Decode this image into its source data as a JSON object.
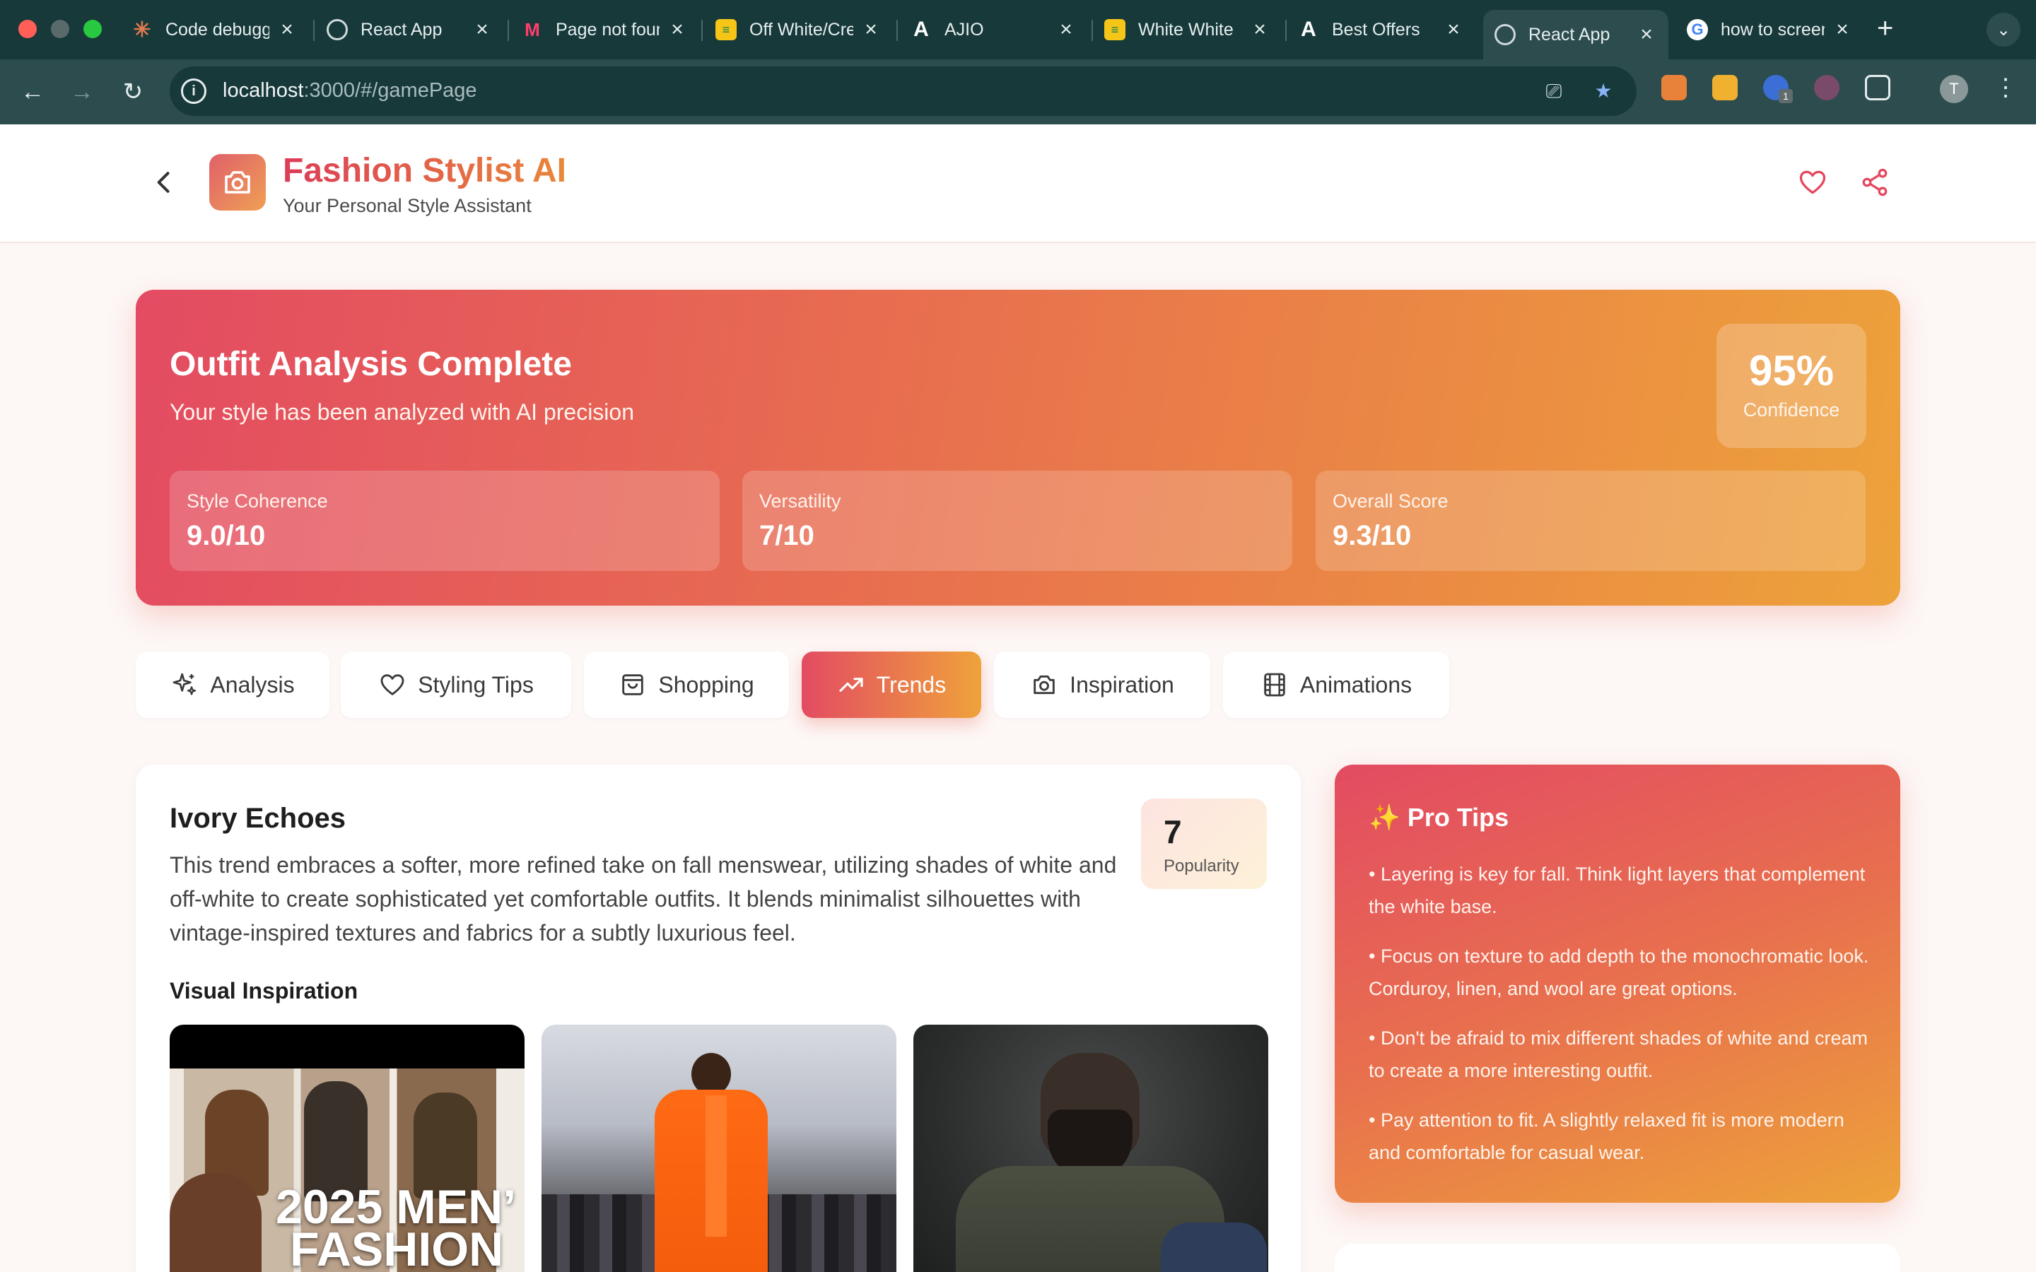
{
  "browser": {
    "tabs": [
      {
        "title": "Code debugging",
        "icon": "claude-icon"
      },
      {
        "title": "React App",
        "icon": "globe-icon"
      },
      {
        "title": "Page not found",
        "icon": "myntra-icon"
      },
      {
        "title": "Off White/Cream",
        "icon": "sticky-note-icon"
      },
      {
        "title": "AJIO",
        "icon": "ajio-icon"
      },
      {
        "title": "White White",
        "icon": "sticky-note-icon"
      },
      {
        "title": "Best Offers",
        "icon": "ajio-icon"
      },
      {
        "title": "React App",
        "icon": "globe-icon",
        "active": true
      },
      {
        "title": "how to screenshot",
        "icon": "google-icon"
      }
    ],
    "url_host": "localhost",
    "url_path": ":3000/#/gamePage",
    "profile_initial": "T",
    "extension_badge": "1"
  },
  "header": {
    "title": "Fashion Stylist AI",
    "subtitle": "Your Personal Style Assistant"
  },
  "hero": {
    "title": "Outfit Analysis Complete",
    "subtitle": "Your style has been analyzed with AI precision",
    "confidence_value": "95%",
    "confidence_label": "Confidence",
    "metrics": [
      {
        "label": "Style Coherence",
        "value": "9.0/10"
      },
      {
        "label": "Versatility",
        "value": "7/10"
      },
      {
        "label": "Overall Score",
        "value": "9.3/10"
      }
    ]
  },
  "tabs": [
    {
      "label": "Analysis",
      "icon": "sparkles-icon"
    },
    {
      "label": "Styling Tips",
      "icon": "heart-icon"
    },
    {
      "label": "Shopping",
      "icon": "shopping-bag-icon"
    },
    {
      "label": "Trends",
      "icon": "trending-up-icon",
      "active": true
    },
    {
      "label": "Inspiration",
      "icon": "camera-icon"
    },
    {
      "label": "Animations",
      "icon": "film-icon"
    }
  ],
  "trend": {
    "name": "Ivory Echoes",
    "description": "This trend embraces a softer, more refined take on fall menswear, utilizing shades of white and off-white to create sophisticated yet comfortable outfits. It blends minimalist silhouettes with vintage-inspired textures and fabrics for a subtly luxurious feel.",
    "popularity_value": "7",
    "popularity_label": "Popularity",
    "visual_title": "Visual Inspiration",
    "image1_text_line1": "2025 MEN’",
    "image1_text_line2": "FASHION"
  },
  "pro_tips": {
    "title": "✨ Pro Tips",
    "items": [
      "• Layering is key for fall. Think light layers that complement the white base.",
      "• Focus on texture to add depth to the monochromatic look. Corduroy, linen, and wool are great options.",
      "• Don't be afraid to mix different shades of white and cream to create a more interesting outfit.",
      "• Pay attention to fit. A slightly relaxed fit is more modern and comfortable for casual wear."
    ]
  },
  "colors": {
    "accent_start": "#e34b62",
    "accent_end": "#eda23a",
    "chrome_dark": "#17393a",
    "chrome_toolbar": "#2c4c4e"
  }
}
